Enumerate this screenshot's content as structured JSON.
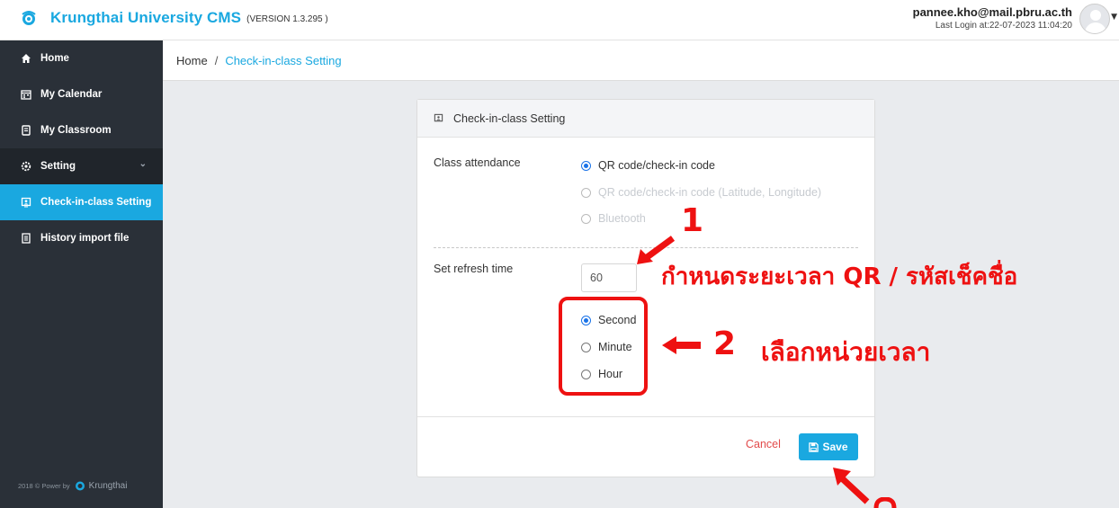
{
  "header": {
    "brand_name": "Krungthai University CMS",
    "version": "(VERSION 1.3.295 )",
    "user_email": "pannee.kho@mail.pbru.ac.th",
    "last_login": "Last Login at:22-07-2023 11:04:20"
  },
  "sidebar": {
    "items": [
      {
        "label": "Home",
        "icon": "home-icon"
      },
      {
        "label": "My Calendar",
        "icon": "calendar-icon"
      },
      {
        "label": "My Classroom",
        "icon": "book-icon"
      },
      {
        "label": "Setting",
        "icon": "gear-icon"
      },
      {
        "label": "Check-in-class Setting",
        "icon": "checkin-icon"
      },
      {
        "label": "History import file",
        "icon": "file-icon"
      }
    ],
    "footer_prefix": "2018 © Power by",
    "footer_brand": "Krungthai"
  },
  "breadcrumb": {
    "home": "Home",
    "separator": "/",
    "current": "Check-in-class Setting"
  },
  "card": {
    "title": "Check-in-class Setting",
    "attendance_label": "Class attendance",
    "attendance_options": [
      {
        "label": "QR code/check-in code",
        "selected": true,
        "disabled": false
      },
      {
        "label": "QR code/check-in code (Latitude, Longitude)",
        "selected": false,
        "disabled": true
      },
      {
        "label": "Bluetooth",
        "selected": false,
        "disabled": true
      }
    ],
    "refresh_label": "Set refresh time",
    "refresh_value": "60",
    "unit_options": [
      {
        "label": "Second",
        "selected": true
      },
      {
        "label": "Minute",
        "selected": false
      },
      {
        "label": "Hour",
        "selected": false
      }
    ],
    "cancel_label": "Cancel",
    "save_label": "Save"
  },
  "annotations": {
    "step1_num": "1",
    "step1_text": "กำหนดระยะเวลา QR / รหัสเช็คชื่อ",
    "step2_num": "2",
    "step2_text": "เลือกหน่วยเวลา",
    "color": "#ee1111"
  },
  "colors": {
    "accent": "#1aa8e0",
    "sidebar_bg": "#2a3038",
    "cancel": "#e24b4b"
  }
}
